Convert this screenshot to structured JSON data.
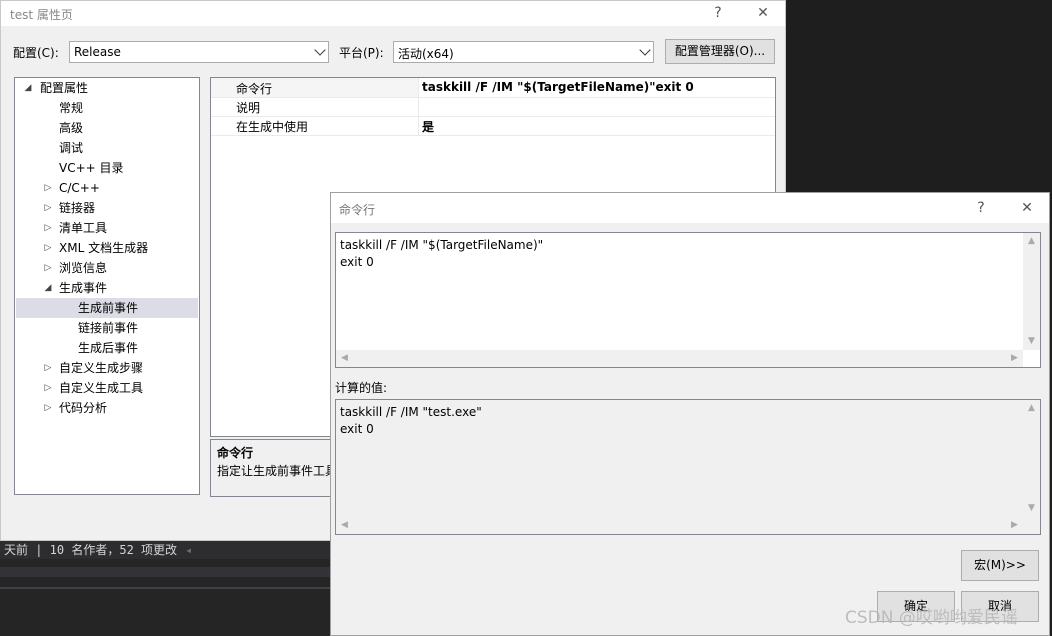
{
  "background": {
    "status_text": "天前 | 10 名作者，52 项更改",
    "status_arrow": "◂"
  },
  "property_window": {
    "title": "test 属性页",
    "help_icon": "?",
    "close_icon": "✕",
    "config_label": "配置(C):",
    "config_value": "Release",
    "platform_label": "平台(P):",
    "platform_value": "活动(x64)",
    "config_manager_button": "配置管理器(O)...",
    "tree": [
      {
        "label": "配置属性",
        "expander": "◢"
      },
      {
        "label": "常规",
        "expander": ""
      },
      {
        "label": "高级",
        "expander": ""
      },
      {
        "label": "调试",
        "expander": ""
      },
      {
        "label": "VC++ 目录",
        "expander": ""
      },
      {
        "label": "C/C++",
        "expander": "▷"
      },
      {
        "label": "链接器",
        "expander": "▷"
      },
      {
        "label": "清单工具",
        "expander": "▷"
      },
      {
        "label": "XML 文档生成器",
        "expander": "▷"
      },
      {
        "label": "浏览信息",
        "expander": "▷"
      },
      {
        "label": "生成事件",
        "expander": "◢"
      },
      {
        "label": "生成前事件",
        "expander": ""
      },
      {
        "label": "链接前事件",
        "expander": ""
      },
      {
        "label": "生成后事件",
        "expander": ""
      },
      {
        "label": "自定义生成步骤",
        "expander": "▷"
      },
      {
        "label": "自定义生成工具",
        "expander": "▷"
      },
      {
        "label": "代码分析",
        "expander": "▷"
      }
    ],
    "grid": [
      {
        "key": "命令行",
        "value": "taskkill /F /IM \"$(TargetFileName)\"exit 0"
      },
      {
        "key": "说明",
        "value": ""
      },
      {
        "key": "在生成中使用",
        "value": "是"
      }
    ],
    "description": {
      "title": "命令行",
      "text": "指定让生成前事件工具"
    }
  },
  "command_dialog": {
    "title": "命令行",
    "help_icon": "?",
    "close_icon": "✕",
    "command_text": "taskkill /F /IM \"$(TargetFileName)\"\nexit 0",
    "evaluated_label": "计算的值:",
    "evaluated_text": "taskkill /F /IM \"test.exe\"\nexit 0",
    "macros_button": "宏(M)>>",
    "ok_button": "确定",
    "cancel_button": "取消"
  },
  "watermark": "CSDN @哎哟哟爱民谣",
  "colors": {
    "selection": "#dcdce6",
    "window_bg": "#f0f0f0",
    "ide_bg": "#1e1e1e"
  }
}
